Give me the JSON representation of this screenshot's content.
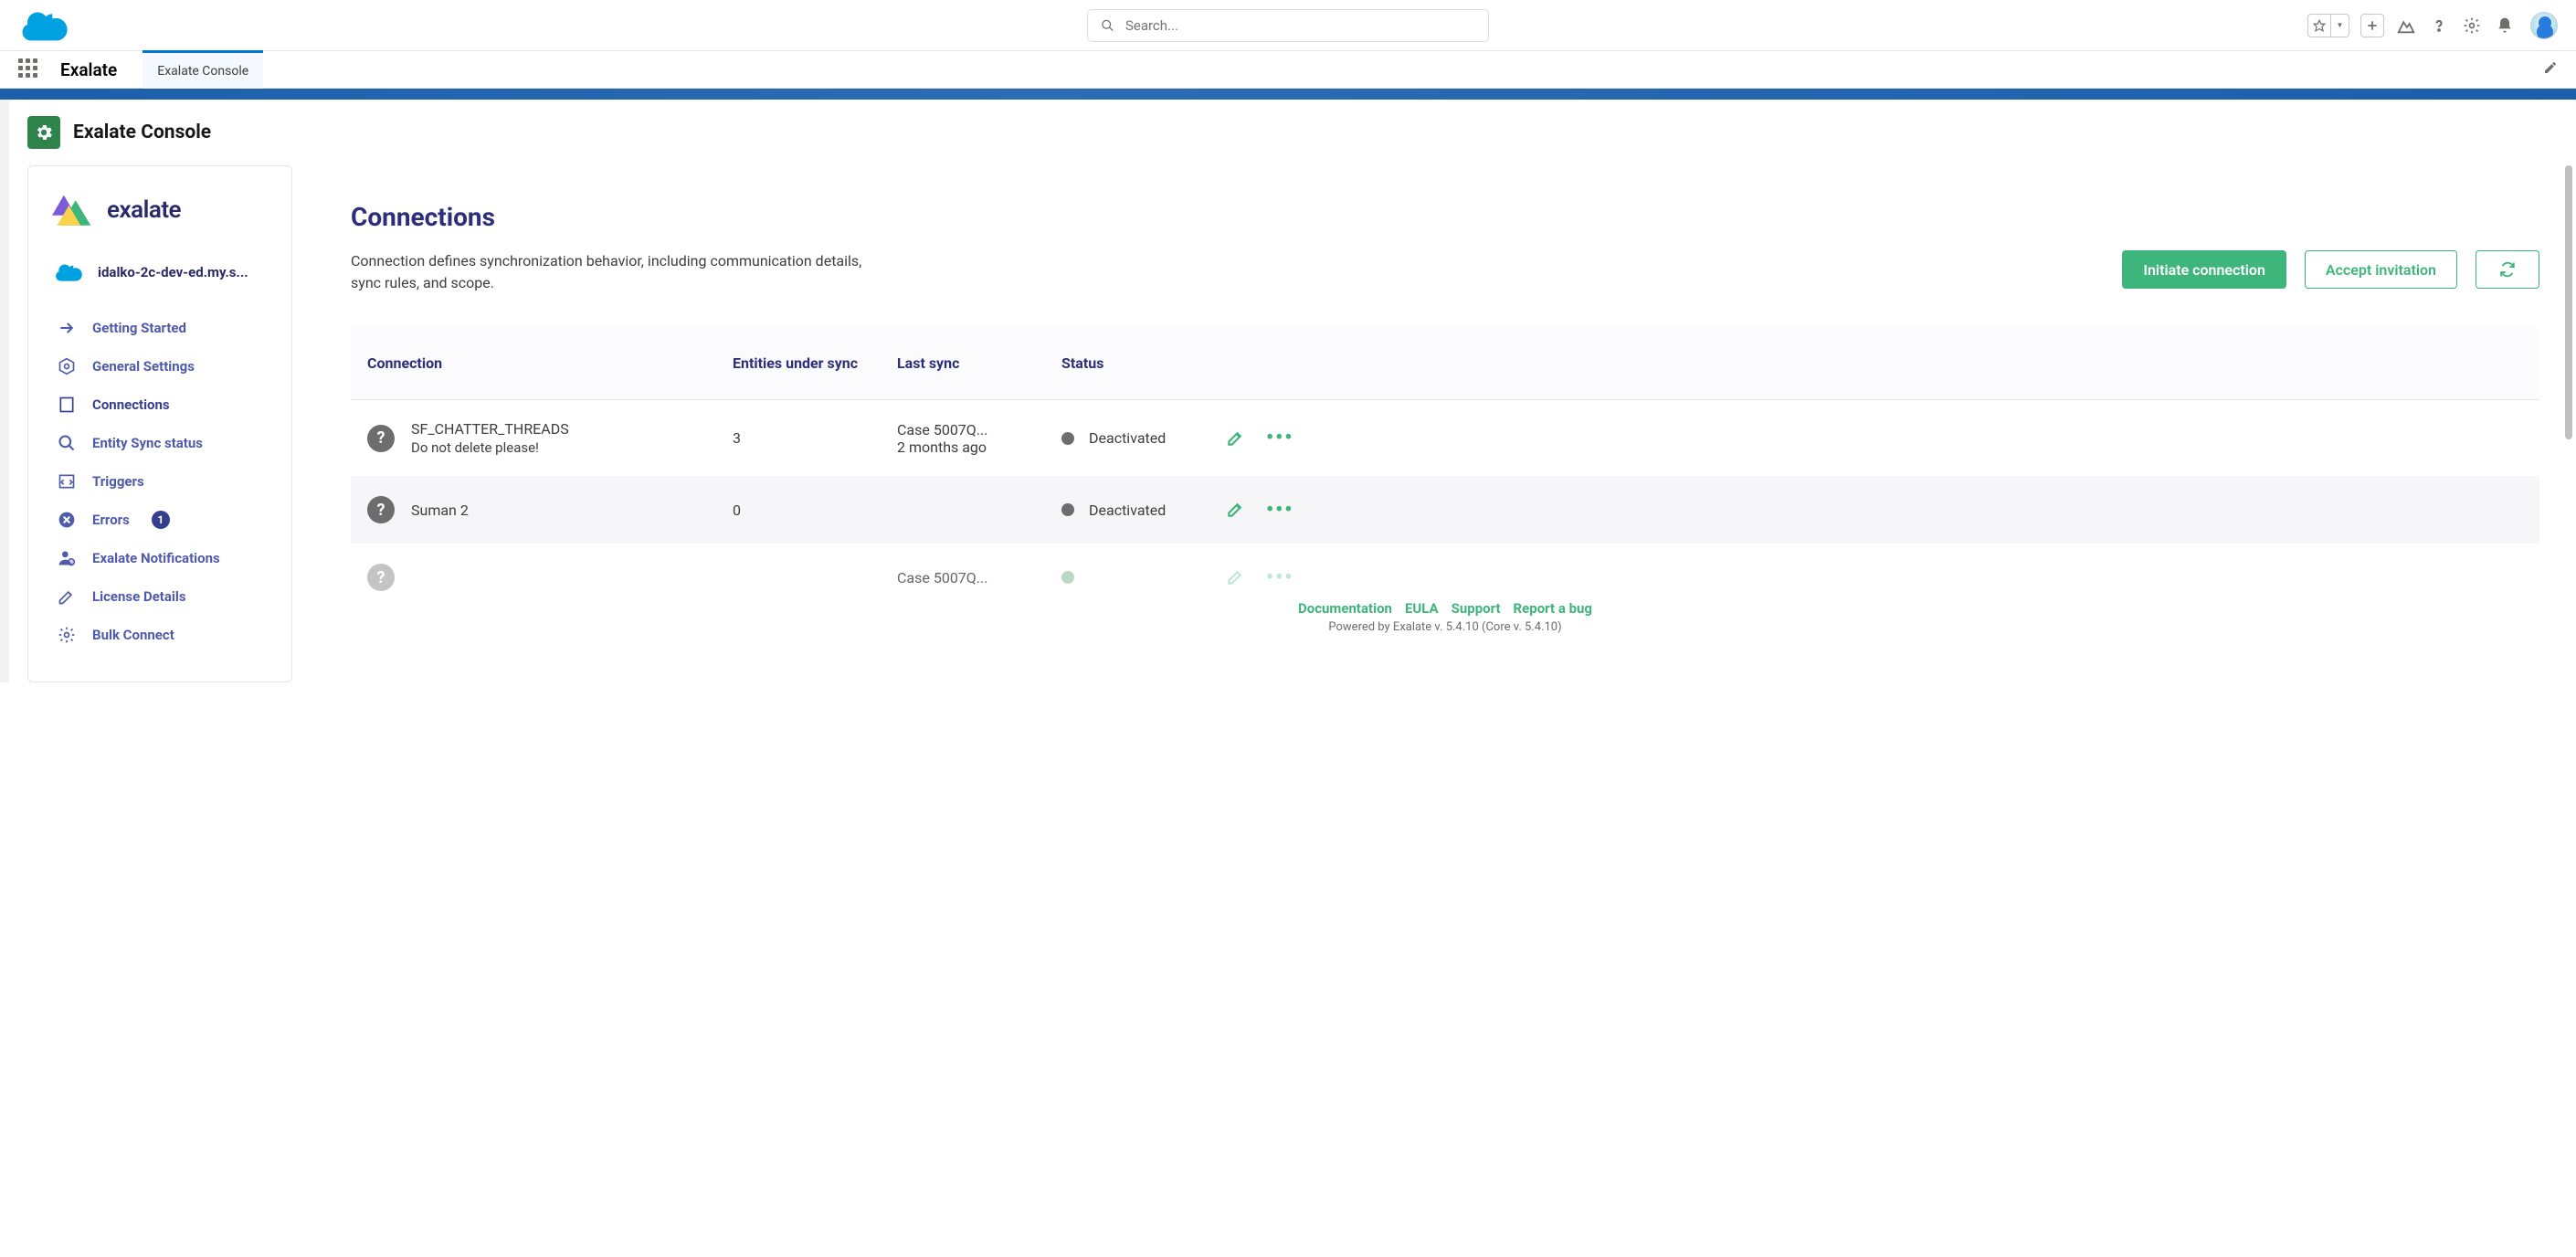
{
  "header": {
    "search_placeholder": "Search..."
  },
  "nav": {
    "app_name": "Exalate",
    "tab_label": "Exalate Console"
  },
  "console": {
    "title": "Exalate Console"
  },
  "sidebar": {
    "brand": "exalate",
    "instance": "idalko-2c-dev-ed.my.s...",
    "items": [
      {
        "label": "Getting Started"
      },
      {
        "label": "General Settings"
      },
      {
        "label": "Connections"
      },
      {
        "label": "Entity Sync status"
      },
      {
        "label": "Triggers"
      },
      {
        "label": "Errors",
        "badge": "1"
      },
      {
        "label": "Exalate Notifications"
      },
      {
        "label": "License Details"
      },
      {
        "label": "Bulk Connect"
      }
    ]
  },
  "main": {
    "title": "Connections",
    "description": "Connection defines synchronization behavior, including communication details, sync rules, and scope.",
    "initiate_btn": "Initiate connection",
    "accept_btn": "Accept invitation",
    "columns": {
      "connection": "Connection",
      "entities": "Entities under sync",
      "last_sync": "Last sync",
      "status": "Status"
    },
    "rows": [
      {
        "name": "SF_CHATTER_THREADS",
        "sub": "Do not delete please!",
        "entities": "3",
        "last_sync_line1": "Case 5007Q...",
        "last_sync_line2": "2 months ago",
        "status": "Deactivated",
        "status_color": "grey"
      },
      {
        "name": "Suman 2",
        "sub": "",
        "entities": "0",
        "last_sync_line1": "",
        "last_sync_line2": "",
        "status": "Deactivated",
        "status_color": "grey"
      },
      {
        "name": "",
        "sub": "",
        "entities": "",
        "last_sync_line1": "Case 5007Q...",
        "last_sync_line2": "",
        "status": "",
        "status_color": "green"
      }
    ]
  },
  "footer": {
    "links": [
      "Documentation",
      "EULA",
      "Support",
      "Report a bug"
    ],
    "powered": "Powered by Exalate v. 5.4.10 (Core v. 5.4.10)"
  }
}
